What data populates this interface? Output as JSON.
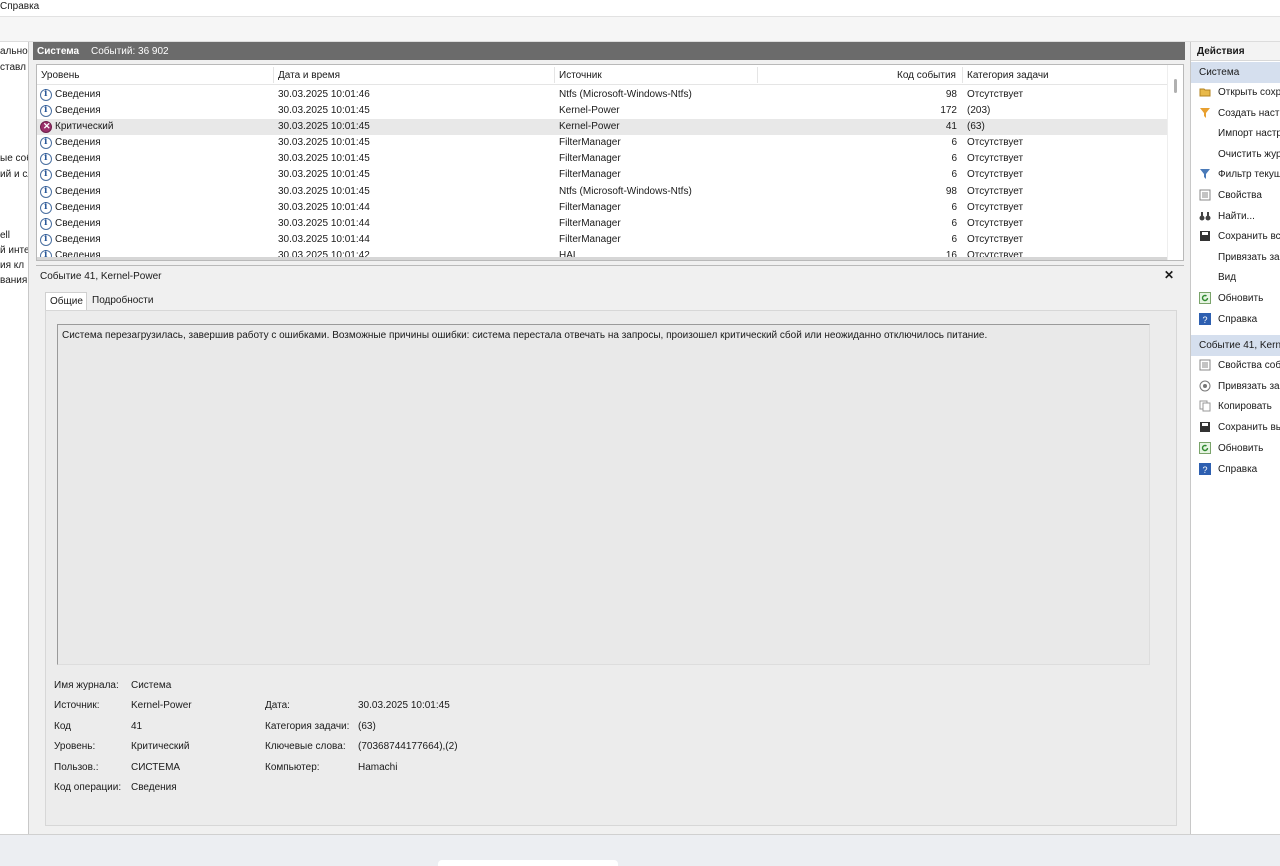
{
  "menu": {
    "help": "Справка"
  },
  "tree": [
    "ально",
    "ставл",
    "ые соб",
    "ий и сл",
    "ell",
    "й инте",
    "ия кл",
    "вания"
  ],
  "center": {
    "log_name": "Система",
    "event_count": "Событий: 36 902"
  },
  "columns": {
    "level": "Уровень",
    "datetime": "Дата и время",
    "source": "Источник",
    "event_id": "Код события",
    "task_category": "Категория задачи"
  },
  "events": [
    {
      "icon": "info-icon",
      "level": "Сведения",
      "datetime": "30.03.2025 10:01:46",
      "source": "Ntfs (Microsoft-Windows-Ntfs)",
      "event_id": "98",
      "category": "Отсутствует"
    },
    {
      "icon": "info-icon",
      "level": "Сведения",
      "datetime": "30.03.2025 10:01:45",
      "source": "Kernel-Power",
      "event_id": "172",
      "category": "(203)"
    },
    {
      "icon": "critical-icon",
      "level": "Критический",
      "datetime": "30.03.2025 10:01:45",
      "source": "Kernel-Power",
      "event_id": "41",
      "category": "(63)",
      "selected": true
    },
    {
      "icon": "info-icon",
      "level": "Сведения",
      "datetime": "30.03.2025 10:01:45",
      "source": "FilterManager",
      "event_id": "6",
      "category": "Отсутствует"
    },
    {
      "icon": "info-icon",
      "level": "Сведения",
      "datetime": "30.03.2025 10:01:45",
      "source": "FilterManager",
      "event_id": "6",
      "category": "Отсутствует"
    },
    {
      "icon": "info-icon",
      "level": "Сведения",
      "datetime": "30.03.2025 10:01:45",
      "source": "FilterManager",
      "event_id": "6",
      "category": "Отсутствует"
    },
    {
      "icon": "info-icon",
      "level": "Сведения",
      "datetime": "30.03.2025 10:01:45",
      "source": "Ntfs (Microsoft-Windows-Ntfs)",
      "event_id": "98",
      "category": "Отсутствует"
    },
    {
      "icon": "info-icon",
      "level": "Сведения",
      "datetime": "30.03.2025 10:01:44",
      "source": "FilterManager",
      "event_id": "6",
      "category": "Отсутствует"
    },
    {
      "icon": "info-icon",
      "level": "Сведения",
      "datetime": "30.03.2025 10:01:44",
      "source": "FilterManager",
      "event_id": "6",
      "category": "Отсутствует"
    },
    {
      "icon": "info-icon",
      "level": "Сведения",
      "datetime": "30.03.2025 10:01:44",
      "source": "FilterManager",
      "event_id": "6",
      "category": "Отсутствует"
    },
    {
      "icon": "info-icon",
      "level": "Сведения",
      "datetime": "30.03.2025 10:01:42",
      "source": "HAL",
      "event_id": "16",
      "category": "Отсутствует"
    }
  ],
  "detail": {
    "title": "Событие 41, Kernel-Power",
    "tab_general": "Общие",
    "tab_details": "Подробности",
    "description": "Система перезагрузилась, завершив работу с ошибками. Возможные причины ошибки: система перестала отвечать на запросы, произошел критический сбой или неожиданно отключилось питание.",
    "props": {
      "log_name_label": "Имя журнала:",
      "log_name": "Система",
      "source_label": "Источник:",
      "source": "Kernel-Power",
      "date_label": "Дата:",
      "date": "30.03.2025 10:01:45",
      "code_label": "Код",
      "code": "41",
      "task_label": "Категория задачи:",
      "task": "(63)",
      "level_label": "Уровень:",
      "level": "Критический",
      "keywords_label": "Ключевые слова:",
      "keywords": "(70368744177664),(2)",
      "user_label": "Пользов.:",
      "user": "СИСТЕМА",
      "computer_label": "Компьютер:",
      "computer": "Hamachi",
      "opcode_label": "Код операции:",
      "opcode": "Сведения"
    }
  },
  "actions": {
    "title": "Действия",
    "section1": "Система",
    "items1": [
      {
        "icon": "folder-open-icon",
        "label": "Открыть сохр"
      },
      {
        "icon": "filter-create-icon",
        "label": "Создать наст"
      },
      {
        "icon": "",
        "label": "Импорт настр"
      },
      {
        "icon": "",
        "label": "Очистить жур"
      },
      {
        "icon": "filter-icon",
        "label": "Фильтр текущ"
      },
      {
        "icon": "properties-icon",
        "label": "Свойства"
      },
      {
        "icon": "binoculars-icon",
        "label": "Найти..."
      },
      {
        "icon": "save-icon",
        "label": "Сохранить вс"
      },
      {
        "icon": "",
        "label": "Привязать за"
      },
      {
        "icon": "",
        "label": "Вид"
      },
      {
        "icon": "refresh-icon",
        "label": "Обновить"
      },
      {
        "icon": "help-icon",
        "label": "Справка"
      }
    ],
    "section2": "Событие 41, Kerne",
    "items2": [
      {
        "icon": "properties-icon",
        "label": "Свойства соб"
      },
      {
        "icon": "attach-task-icon",
        "label": "Привязать за"
      },
      {
        "icon": "copy-icon",
        "label": "Копировать"
      },
      {
        "icon": "save-icon",
        "label": "Сохранить вы"
      },
      {
        "icon": "refresh-icon",
        "label": "Обновить"
      },
      {
        "icon": "help-icon",
        "label": "Справка"
      }
    ]
  }
}
